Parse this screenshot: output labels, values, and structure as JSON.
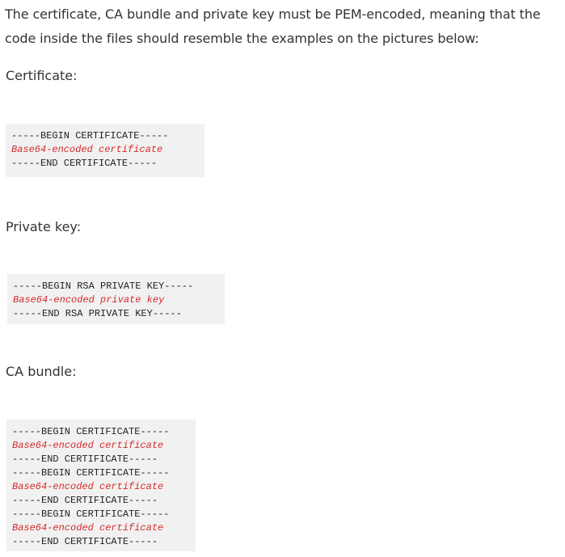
{
  "intro": "The certificate, CA bundle and private key must be PEM-encoded, meaning that the code inside the files should resemble the examples on the pictures below:",
  "sections": [
    {
      "heading": "Certificate:",
      "code": [
        "-----BEGIN CERTIFICATE-----",
        "Base64-encoded certificate",
        "-----END CERTIFICATE-----"
      ]
    },
    {
      "heading": "Private key:",
      "code": [
        "-----BEGIN RSA PRIVATE KEY-----",
        "Base64-encoded private key",
        "-----END RSA PRIVATE KEY-----"
      ]
    },
    {
      "heading": "CA bundle:",
      "code": [
        "-----BEGIN CERTIFICATE-----",
        "Base64-encoded certificate",
        "-----END CERTIFICATE-----",
        "-----BEGIN CERTIFICATE-----",
        "Base64-encoded certificate",
        "-----END CERTIFICATE-----",
        "-----BEGIN CERTIFICATE-----",
        "Base64-encoded certificate",
        "-----END CERTIFICATE-----"
      ]
    }
  ],
  "colors": {
    "text": "#333333",
    "code_background": "#f1f1f1",
    "code_delimiter": "#222222",
    "code_placeholder": "#d62a2a"
  }
}
